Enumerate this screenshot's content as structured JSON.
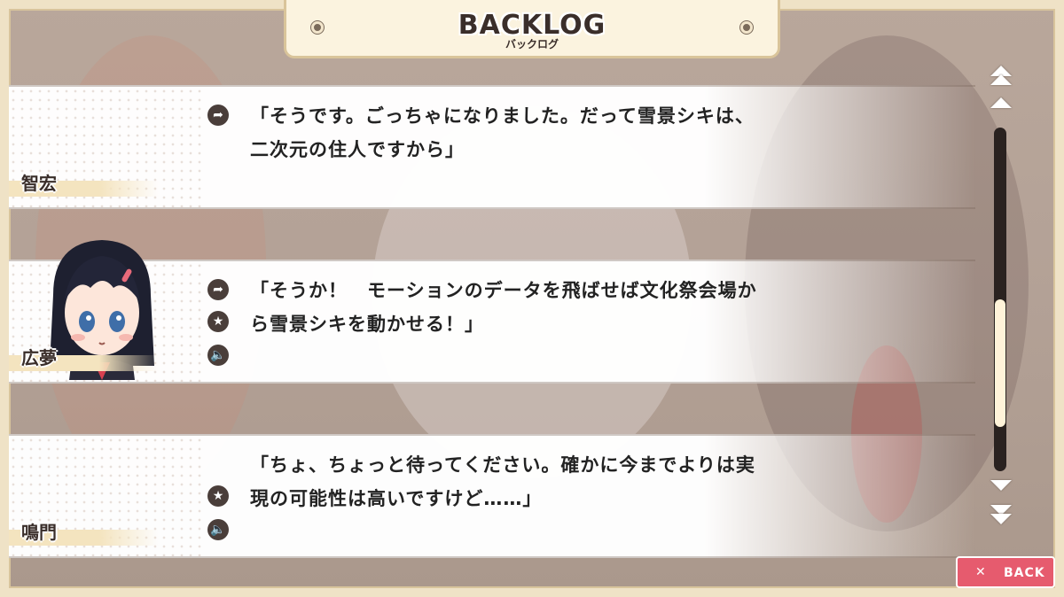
{
  "header": {
    "title": "BACKLOG",
    "subtitle": "バックログ"
  },
  "entries": [
    {
      "speaker": "智宏",
      "line1": "「そうです。ごっちゃになりました。だって雪景シキは、",
      "line2": "二次元の住人ですから」",
      "icons": [
        "jump-icon"
      ]
    },
    {
      "speaker": "広夢",
      "line1": "「そうか！　モーションのデータを飛ばせば文化祭会場か",
      "line2": "ら雪景シキを動かせる！」",
      "icons": [
        "jump-icon",
        "star-icon",
        "voice-icon"
      ]
    },
    {
      "speaker": "鳴門",
      "line1": "「ちょ、ちょっと待ってください。確かに今までよりは実",
      "line2": "現の可能性は高いですけど……」",
      "icons": [
        "star-icon",
        "voice-icon"
      ]
    }
  ],
  "scroll": {
    "position": 0.8
  },
  "back": {
    "label": "BACK",
    "icon": "close-icon"
  },
  "colors": {
    "accent": "#e65b6e",
    "frame": "#efe2c6",
    "panel": "#fbf3df",
    "text": "#3a2e2a"
  }
}
